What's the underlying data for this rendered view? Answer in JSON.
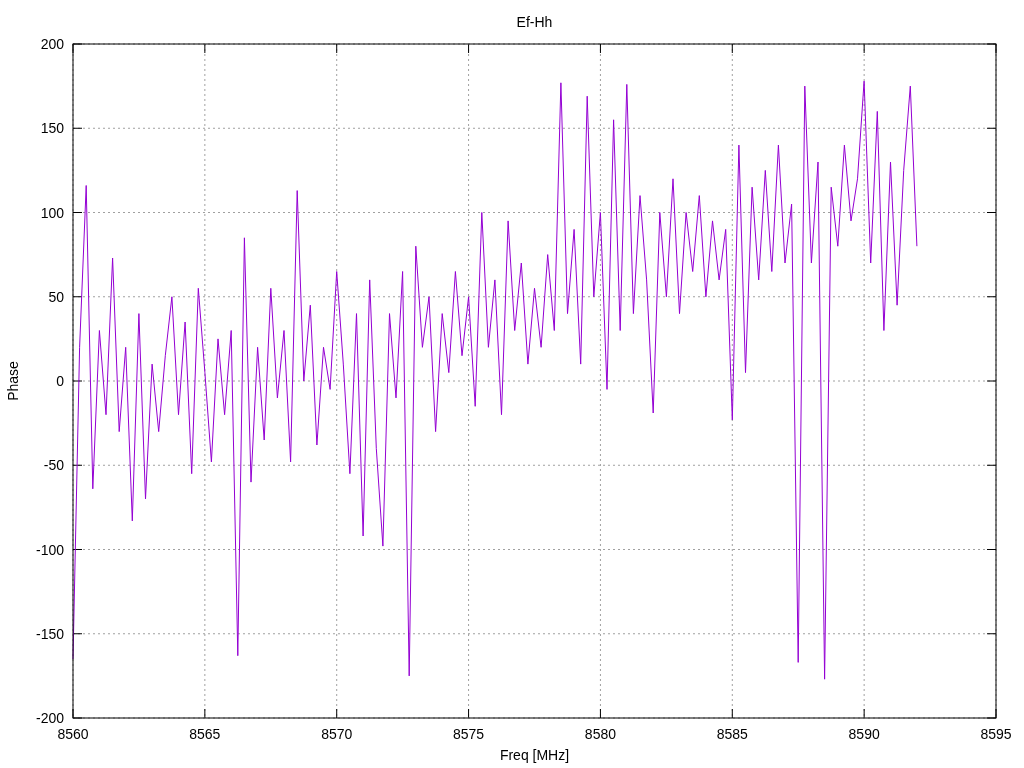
{
  "chart_data": {
    "type": "line",
    "title": "Ef-Hh",
    "xlabel": "Freq [MHz]",
    "ylabel": "Phase",
    "grid": true,
    "xlim": [
      8560,
      8595
    ],
    "ylim": [
      -200,
      200
    ],
    "xticks": [
      8560,
      8565,
      8570,
      8575,
      8580,
      8585,
      8590,
      8595
    ],
    "yticks": [
      -200,
      -150,
      -100,
      -50,
      0,
      50,
      100,
      150,
      200
    ],
    "x": [
      8560,
      8560.25,
      8560.5,
      8560.75,
      8561,
      8561.25,
      8561.5,
      8561.75,
      8562,
      8562.25,
      8562.5,
      8562.75,
      8563,
      8563.25,
      8563.5,
      8563.75,
      8564,
      8564.25,
      8564.5,
      8564.75,
      8565,
      8565.25,
      8565.5,
      8565.75,
      8566,
      8566.25,
      8566.5,
      8566.75,
      8567,
      8567.25,
      8567.5,
      8567.75,
      8568,
      8568.25,
      8568.5,
      8568.75,
      8569,
      8569.25,
      8569.5,
      8569.75,
      8570,
      8570.25,
      8570.5,
      8570.75,
      8571,
      8571.25,
      8571.5,
      8571.75,
      8572,
      8572.25,
      8572.5,
      8572.75,
      8573,
      8573.25,
      8573.5,
      8573.75,
      8574,
      8574.25,
      8574.5,
      8574.75,
      8575,
      8575.25,
      8575.5,
      8575.75,
      8576,
      8576.25,
      8576.5,
      8576.75,
      8577,
      8577.25,
      8577.5,
      8577.75,
      8578,
      8578.25,
      8578.5,
      8578.75,
      8579,
      8579.25,
      8579.5,
      8579.75,
      8580,
      8580.25,
      8580.5,
      8580.75,
      8581,
      8581.25,
      8581.5,
      8581.75,
      8582,
      8582.25,
      8582.5,
      8582.75,
      8583,
      8583.25,
      8583.5,
      8583.75,
      8584,
      8584.25,
      8584.5,
      8584.75,
      8585,
      8585.25,
      8585.5,
      8585.75,
      8586,
      8586.25,
      8586.5,
      8586.75,
      8587,
      8587.25,
      8587.5,
      8587.75,
      8588,
      8588.25,
      8588.5,
      8588.75,
      8589,
      8589.25,
      8589.5,
      8589.75,
      8590,
      8590.25,
      8590.5,
      8590.75,
      8591,
      8591.25,
      8591.5,
      8591.75,
      8592
    ],
    "series": [
      {
        "color": "#9400d3",
        "values": [
          -165,
          20,
          116,
          -64,
          30,
          -20,
          73,
          -30,
          20,
          -83,
          40,
          -70,
          10,
          -30,
          15,
          50,
          -20,
          35,
          -55,
          55,
          5,
          -48,
          25,
          -20,
          30,
          -163,
          85,
          -60,
          20,
          -35,
          55,
          -10,
          30,
          -48,
          113,
          0,
          45,
          -38,
          20,
          -5,
          65,
          10,
          -55,
          40,
          -92,
          60,
          -40,
          -98,
          40,
          -10,
          65,
          -175,
          80,
          20,
          50,
          -30,
          40,
          5,
          65,
          15,
          50,
          -15,
          100,
          20,
          60,
          -20,
          95,
          30,
          70,
          10,
          55,
          20,
          75,
          30,
          177,
          40,
          90,
          10,
          169,
          50,
          100,
          -5,
          155,
          30,
          176,
          40,
          110,
          60,
          -19,
          100,
          50,
          120,
          40,
          100,
          65,
          110,
          50,
          95,
          60,
          90,
          -23,
          140,
          5,
          115,
          60,
          125,
          65,
          140,
          70,
          105,
          -167,
          175,
          70,
          130,
          -177,
          115,
          80,
          140,
          95,
          120,
          178,
          70,
          160,
          30,
          130,
          45,
          125,
          175,
          80
        ]
      }
    ]
  }
}
